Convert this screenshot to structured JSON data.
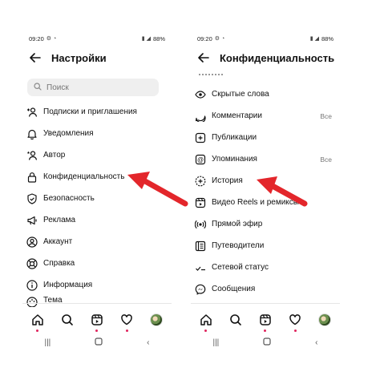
{
  "left_screen": {
    "status": {
      "time": "09:20",
      "battery": "88%"
    },
    "header": {
      "title": "Настройки"
    },
    "search": {
      "placeholder": "Поиск"
    },
    "menu": [
      {
        "label": "Подписки и приглашения",
        "icon": "add-person-icon"
      },
      {
        "label": "Уведомления",
        "icon": "bell-icon"
      },
      {
        "label": "Автор",
        "icon": "person-star-icon"
      },
      {
        "label": "Конфиденциальность",
        "icon": "lock-icon"
      },
      {
        "label": "Безопасность",
        "icon": "shield-check-icon"
      },
      {
        "label": "Реклама",
        "icon": "megaphone-icon"
      },
      {
        "label": "Аккаунт",
        "icon": "account-circle-icon"
      },
      {
        "label": "Справка",
        "icon": "lifebuoy-icon"
      },
      {
        "label": "Информация",
        "icon": "info-icon"
      },
      {
        "label": "Тема",
        "icon": "palette-icon"
      }
    ]
  },
  "right_screen": {
    "status": {
      "time": "09:20",
      "battery": "88%"
    },
    "header": {
      "title": "Конфиденциальность"
    },
    "menu": [
      {
        "label": "Скрытые слова",
        "value": "",
        "icon": "eye-icon"
      },
      {
        "label": "Комментарии",
        "value": "Все",
        "icon": "comment-icon"
      },
      {
        "label": "Публикации",
        "value": "",
        "icon": "post-plus-icon"
      },
      {
        "label": "Упоминания",
        "value": "Все",
        "icon": "at-icon"
      },
      {
        "label": "История",
        "value": "",
        "icon": "story-plus-icon"
      },
      {
        "label": "Видео Reels и ремиксы",
        "value": "",
        "icon": "reels-icon"
      },
      {
        "label": "Прямой эфир",
        "value": "",
        "icon": "live-icon"
      },
      {
        "label": "Путеводители",
        "value": "",
        "icon": "guide-icon"
      },
      {
        "label": "Сетевой статус",
        "value": "",
        "icon": "activity-status-icon"
      },
      {
        "label": "Сообщения",
        "value": "",
        "icon": "messenger-icon"
      }
    ]
  },
  "colors": {
    "arrow": "#e3262b",
    "text": "#111111",
    "muted": "#777777",
    "search_bg": "#efefef",
    "notification_dot": "#e0245e"
  },
  "bottom_nav": [
    "home-icon",
    "search-icon",
    "reels-icon",
    "heart-icon",
    "avatar"
  ],
  "system_nav": [
    "recent-apps-icon",
    "home-button-icon",
    "back-icon"
  ]
}
